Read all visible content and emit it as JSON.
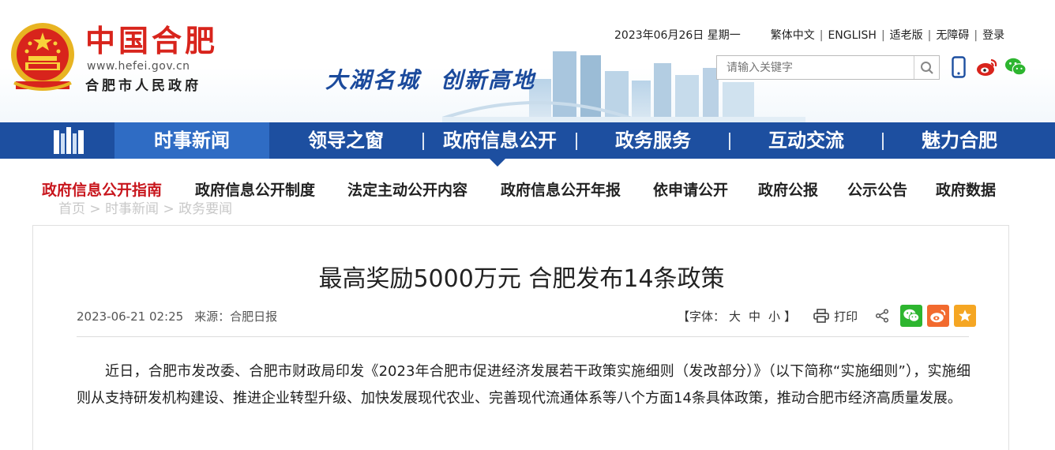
{
  "header": {
    "logo_cn": "中国合肥",
    "logo_url": "www.hefei.gov.cn",
    "logo_sub": "合肥市人民政府",
    "slogan_1": "大湖名城",
    "slogan_2": "创新高地",
    "date": "2023年06月26日 星期一",
    "links": [
      "繁体中文",
      "ENGLISH",
      "适老版",
      "无障碍",
      "登录"
    ],
    "search_placeholder": "请输入关键字"
  },
  "nav": {
    "items": [
      "时事新闻",
      "领导之窗",
      "政府信息公开",
      "政务服务",
      "互动交流",
      "魅力合肥"
    ],
    "active_index": 0
  },
  "subnav": {
    "items": [
      "政府信息公开指南",
      "政府信息公开制度",
      "法定主动公开内容",
      "政府信息公开年报",
      "依申请公开",
      "政府公报",
      "公示公告",
      "政府数据"
    ],
    "active_index": 0
  },
  "breadcrumb": {
    "items": [
      "首页",
      "时事新闻",
      "政务要闻"
    ],
    "separator": ">"
  },
  "article": {
    "title": "最高奖励5000万元 合肥发布14条政策",
    "date": "2023-06-21 02:25",
    "source": "来源：合肥日报",
    "font_label": "【字体：",
    "font_sizes": [
      "大",
      "中",
      "小"
    ],
    "font_close": "】",
    "print_label": "打印",
    "paragraph": "近日，合肥市发改委、合肥市财政局印发《2023年合肥市促进经济发展若干政策实施细则（发改部分）》（以下简称“实施细则”），实施细则从支持研发机构建设、推进企业转型升级、加快发展现代农业、完善现代流通体系等八个方面14条具体政策，推动合肥市经济高质量发展。"
  },
  "colors": {
    "brand_red": "#d8241c",
    "nav_blue": "#1d4fa0",
    "nav_active": "#2f6cc4",
    "sub_active": "#c8161d",
    "wechat_green": "#2db52f",
    "weibo_orange": "#f26a2e",
    "fav_orange": "#f5a623"
  },
  "icons": [
    "national-emblem-icon",
    "search-icon",
    "mobile-icon",
    "weibo-icon",
    "wechat-icon",
    "home-building-icon",
    "print-icon",
    "share-icon",
    "star-icon"
  ]
}
